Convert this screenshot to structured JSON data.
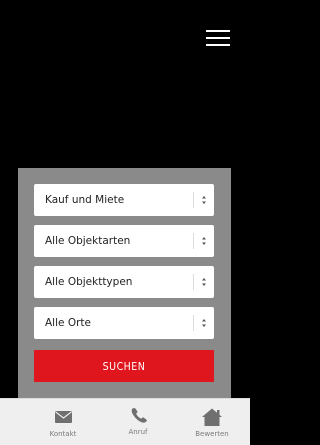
{
  "header": {
    "menu_icon": "hamburger-menu-icon"
  },
  "search": {
    "selects": [
      {
        "label": "Kauf und Miete",
        "arrow_icon": "updown-arrows-icon"
      },
      {
        "label": "Alle Objektarten",
        "arrow_icon": "updown-arrows-icon"
      },
      {
        "label": "Alle Objekttypen",
        "arrow_icon": "updown-arrows-icon"
      },
      {
        "label": "Alle Orte",
        "arrow_icon": "updown-arrows-icon"
      }
    ],
    "button_label": "SUCHEN"
  },
  "bottom_nav": {
    "items": [
      {
        "label": "Kontakt",
        "icon": "envelope-icon"
      },
      {
        "label": "Anruf",
        "icon": "phone-icon"
      },
      {
        "label": "Bewerten",
        "icon": "house-icon"
      }
    ]
  },
  "colors": {
    "background": "#000000",
    "panel": "#8a8a8a",
    "button": "#e0161f",
    "nav_background": "#efefef",
    "nav_icon": "#6f6f6f"
  }
}
